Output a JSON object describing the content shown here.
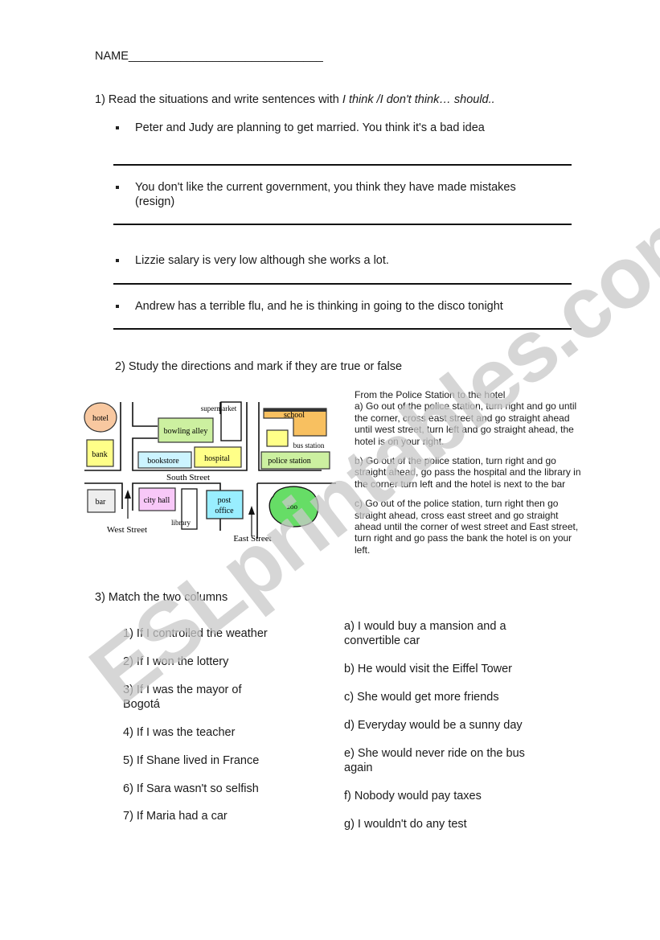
{
  "header": {
    "name_label": "NAME",
    "name_blank": "______________________________"
  },
  "section1": {
    "title_prefix": "1) Read the situations and write sentences with ",
    "title_italic": "I think /I don't think… should..",
    "items": [
      {
        "text": "Peter and Judy are planning to get married. You think it's a bad idea"
      },
      {
        "text": "You don't like the current government, you think they have made mistakes (resign)"
      },
      {
        "text": "Lizzie salary is very low although she works a lot."
      },
      {
        "text": "Andrew has a terrible flu, and he is thinking in going to the disco tonight"
      }
    ]
  },
  "section2": {
    "title": "2)   Study the directions and mark if they are true or false",
    "map": {
      "places": {
        "hotel": "hotel",
        "bank": "bank",
        "bowling_alley": "bowling alley",
        "supermarket": "supermarket",
        "bookstore": "bookstore",
        "hospital": "hospital",
        "school": "school",
        "bus_station": "bus station",
        "police_station": "police station",
        "bar": "bar",
        "city_hall": "city hall",
        "library": "library",
        "post_office_1": "post",
        "post_office_2": "office",
        "zoo": "zoo"
      },
      "streets": {
        "south": "South Street",
        "west": "West Street",
        "east": "East Street"
      },
      "colors": {
        "hotel": "#f8c8a0",
        "bank": "#ffff88",
        "bowling_alley": "#ccf0a0",
        "bookstore": "#ccf4ff",
        "hospital": "#ffff88",
        "school": "#f8c060",
        "bus_station": "#ffff88",
        "police_station": "#ccf0a0",
        "bar": "#eeeeee",
        "city_hall": "#f8c8f8",
        "post_office": "#99eeff",
        "zoo": "#66dd66"
      }
    },
    "directions": {
      "heading": "From the Police Station to the hotel",
      "options": [
        "a) Go out of the police station, turn right and go until the corner, cross east street and go straight ahead until west street, turn left and go straight ahead, the hotel is on your right.",
        "b) Go out of the police station, turn right and go straight ahead, go pass the hospital and the library in the corner turn left and the hotel is next to the bar",
        "c) Go out of the police station, turn right then go straight ahead, cross east street and go straight ahead until the corner of west street and East street, turn right and go pass the bank the hotel is on your left."
      ]
    }
  },
  "section3": {
    "title": "3) Match the two columns",
    "left": [
      "1) If I controlled the weather",
      "2) If I won the lottery",
      "3) If I was the mayor of Bogotá",
      "4) If I was the teacher",
      "5) If Shane lived in France",
      "6) If Sara wasn't so selfish",
      "7) If Maria had a car"
    ],
    "right": [
      "a) I would buy a mansion and a convertible car",
      "b) He would visit the Eiffel Tower",
      "c) She would get more friends",
      "d) Everyday would be a sunny day",
      "e) She would never ride on the bus again",
      "f) Nobody would pay taxes",
      "g) I wouldn't do any test"
    ]
  },
  "watermark": {
    "text": "ESLprintables.com",
    "color": "#c8c8c8"
  }
}
